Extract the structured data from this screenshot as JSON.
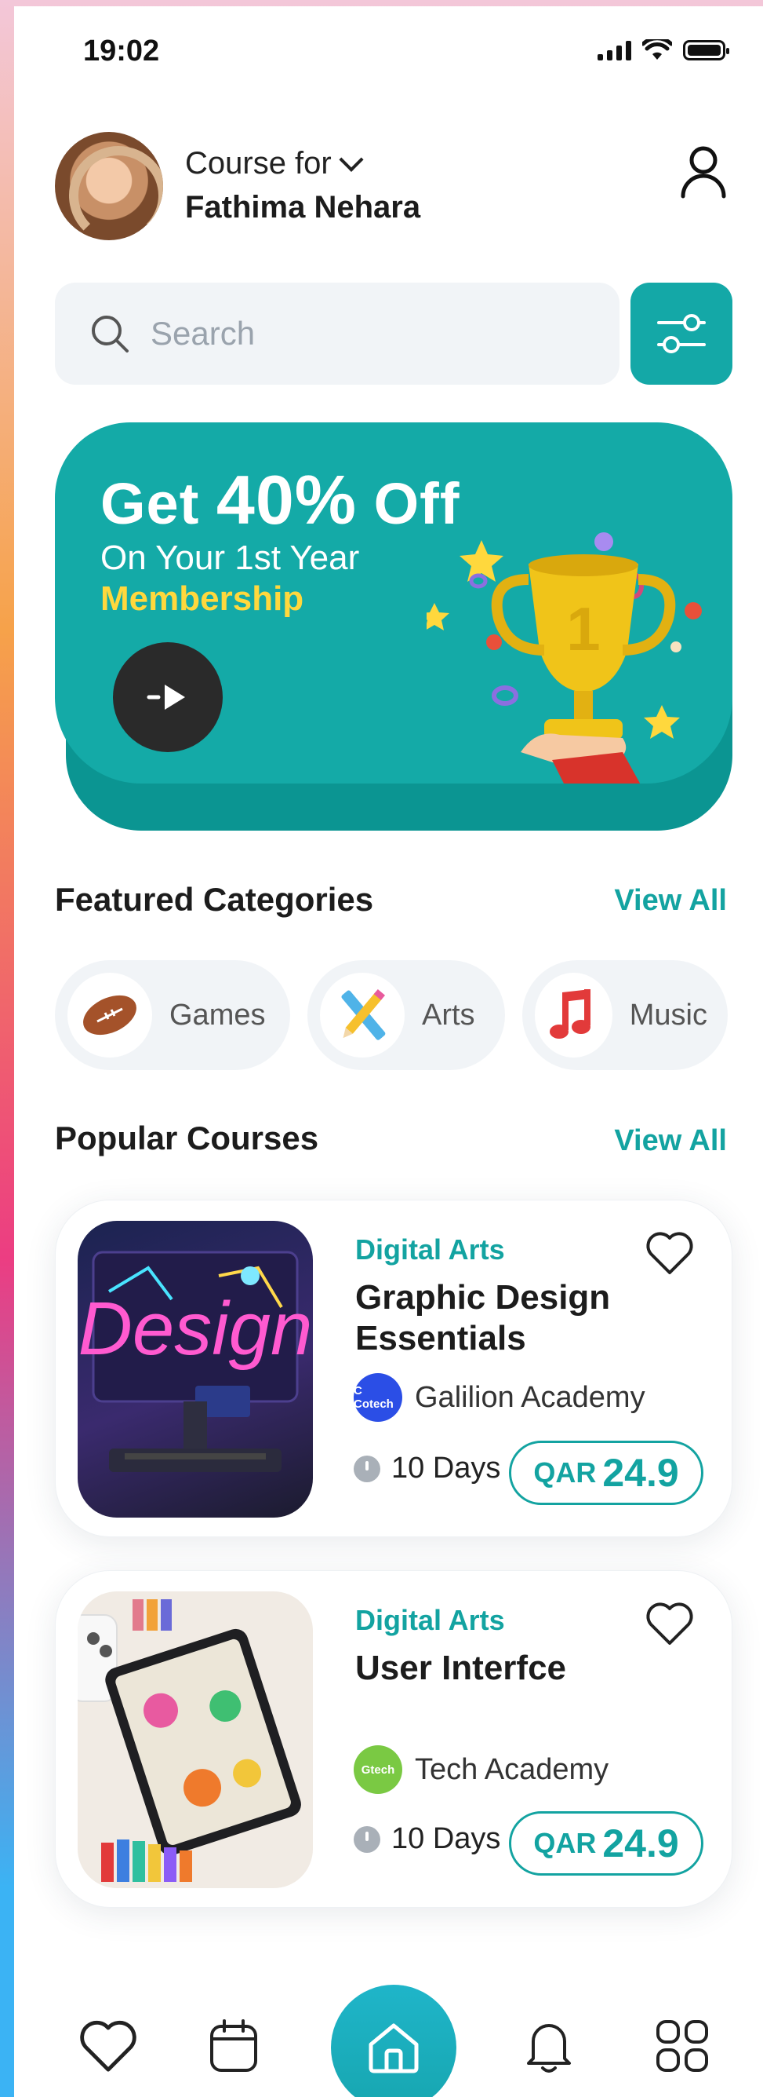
{
  "status_bar": {
    "time": "19:02"
  },
  "header": {
    "course_for_label": "Course for",
    "user_name": "Fathima Nehara"
  },
  "search": {
    "placeholder": "Search"
  },
  "banner": {
    "title_get": "Get",
    "title_percent": "40%",
    "title_off": "Off",
    "subtitle": "On Your 1st Year",
    "highlight": "Membership",
    "colors": {
      "bg": "#14aaa7",
      "highlight": "#ffd83d"
    }
  },
  "featured": {
    "title": "Featured Categories",
    "view_all": "View All",
    "categories": [
      {
        "label": "Games",
        "icon": "football-icon"
      },
      {
        "label": "Arts",
        "icon": "pencil-ruler-icon"
      },
      {
        "label": "Music",
        "icon": "music-note-icon"
      }
    ]
  },
  "popular": {
    "title": "Popular Courses",
    "view_all": "View All",
    "courses": [
      {
        "category": "Digital Arts",
        "title": "Graphic Design Essentials",
        "academy": "Galilion Academy",
        "academy_logo_text": "C Cotech",
        "duration": "10 Days",
        "currency": "QAR",
        "price": "24.9"
      },
      {
        "category": "Digital Arts",
        "title": "User Interfce",
        "academy": "Tech Academy",
        "academy_logo_text": "Gtech",
        "duration": "10 Days",
        "currency": "QAR",
        "price": "24.9"
      }
    ]
  },
  "theme": {
    "accent": "#13a3a1"
  }
}
